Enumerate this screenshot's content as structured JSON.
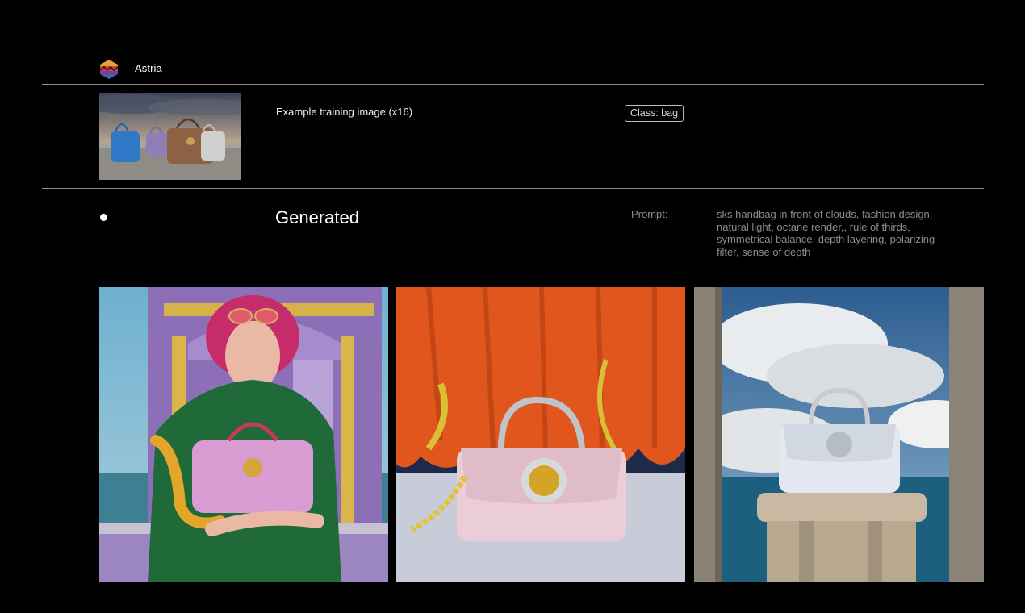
{
  "header": {
    "brand_name": "Astria",
    "logo_icon": "astria-logo-icon"
  },
  "training": {
    "label": "Example training image (x16)",
    "class_badge": "Class: bag"
  },
  "generated": {
    "title": "Generated",
    "prompt_label": "Prompt:",
    "prompt_text": "sks handbag in front of clouds, fashion design, natural light, octane render,, rule of thirds, symmetrical balance, depth layering, polarizing filter, sense of depth"
  },
  "colors": {
    "background": "#000000",
    "text_primary": "#ffffff",
    "text_muted": "#8c8c8c",
    "divider": "#8a8a8a"
  }
}
